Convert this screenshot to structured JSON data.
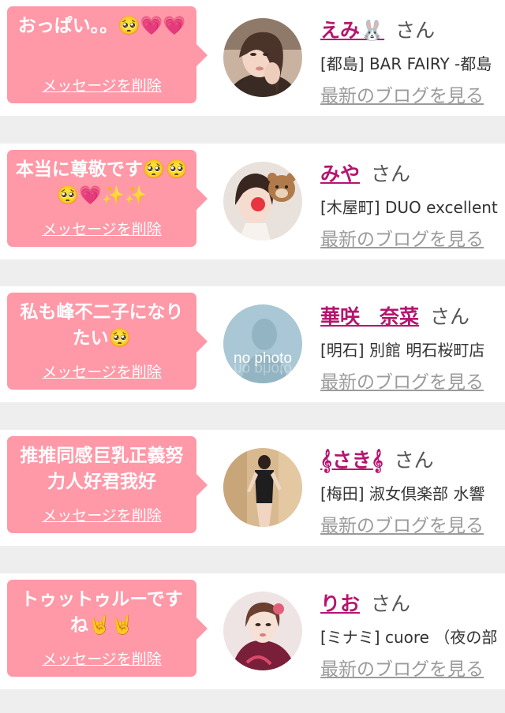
{
  "delete_label": "メッセージを削除",
  "san_label": "さん",
  "blog_label": "最新のブログを見る",
  "colors": {
    "bubble": "#ff98a7",
    "name": "#b5156f",
    "background": "#eeeeee"
  },
  "items": [
    {
      "message": "おっぱい。。🥺💗💗",
      "name": "えみ🐰",
      "shop": "[都島] BAR FAIRY -都島",
      "avatar": "photo-woman-hand-on-face"
    },
    {
      "message": "本当に尊敬です🥺🥺🥺💗✨✨",
      "name": "みや",
      "shop": "[木屋町] DUO excellent",
      "avatar": "photo-woman-with-bear-sticker"
    },
    {
      "message": "私も峰不二子になりたい🥺",
      "name": "華咲　奈菜",
      "shop": "[明石] 別館 明石桜町店",
      "avatar": "no-photo",
      "avatar_text": "no photo"
    },
    {
      "message": "推推同感巨乳正義努力人好君我好",
      "name": "𝄞さき𝄞",
      "shop": "[梅田] 淑女倶楽部 水響",
      "avatar": "photo-woman-in-black-dress"
    },
    {
      "message": "トゥットゥルーですね🤘🤘",
      "name": "りお",
      "shop": "[ミナミ] cuore （夜の部",
      "avatar": "photo-woman-in-kimono"
    }
  ]
}
